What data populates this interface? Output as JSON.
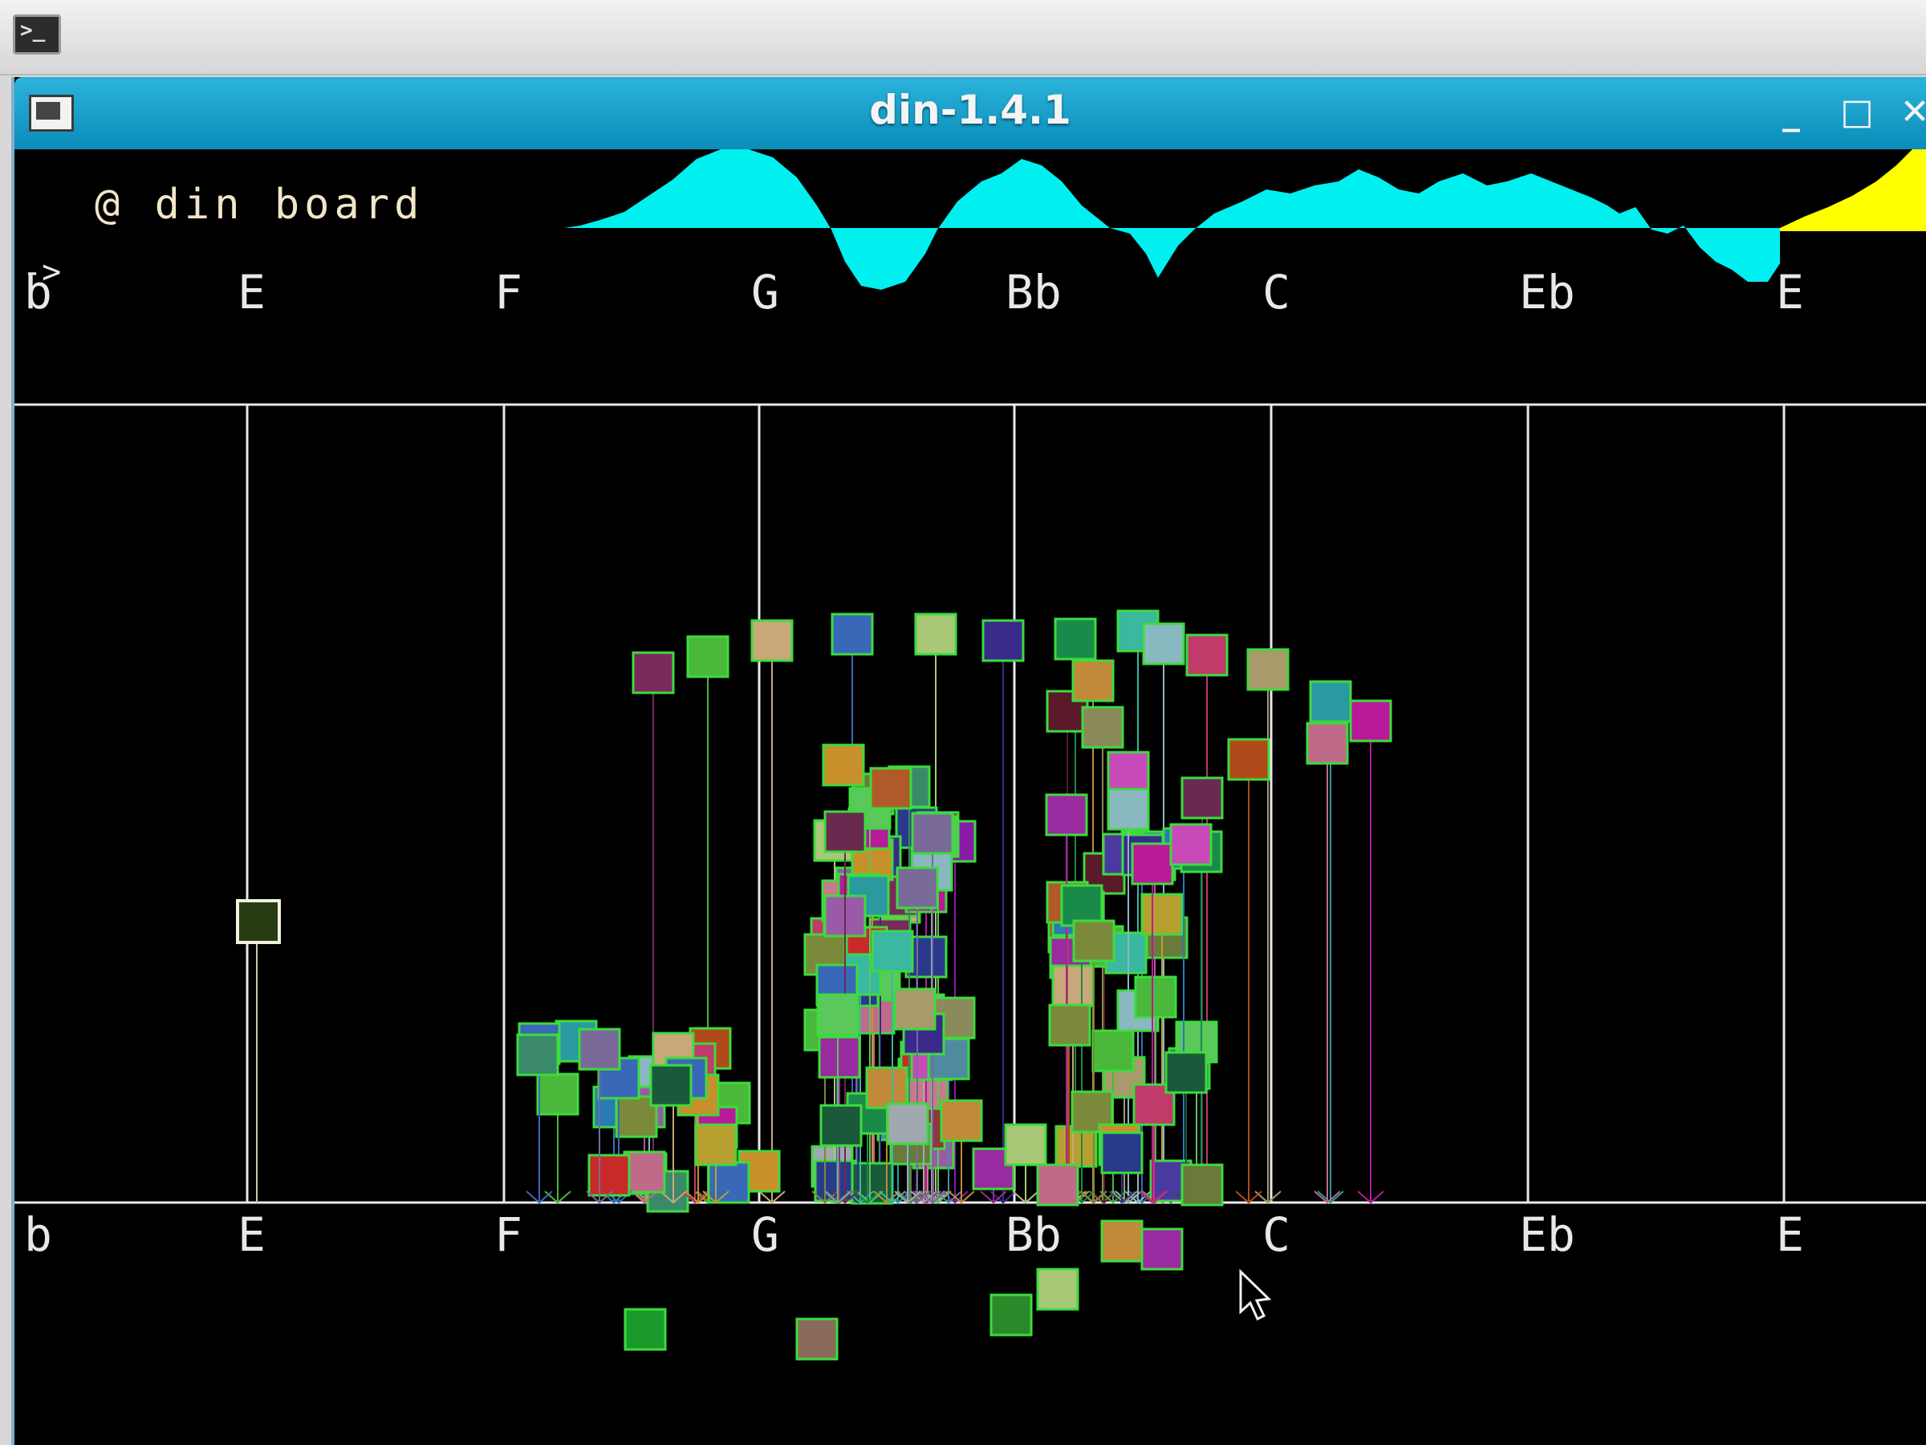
{
  "window": {
    "title": "din-1.4.1",
    "controls": {
      "minimize": "_",
      "maximize": "□",
      "close": "✕"
    },
    "launcher_icon": "terminal-icon"
  },
  "board": {
    "header": "@ din board",
    "prompt": "->",
    "top_notes": [
      "b",
      "E",
      "F",
      "G",
      "Bb",
      "C",
      "Eb",
      "E"
    ],
    "bottom_notes": [
      "b",
      "E",
      "F",
      "G",
      "Bb",
      "C",
      "Eb",
      "E"
    ]
  },
  "colors": {
    "background": "#000000",
    "waveform": "#00f0f0",
    "waveform_tail": "#ffff00",
    "grid": "#e8e8e8",
    "drone_outline": "#3cdc3c",
    "titlebar": "#139fcb"
  }
}
